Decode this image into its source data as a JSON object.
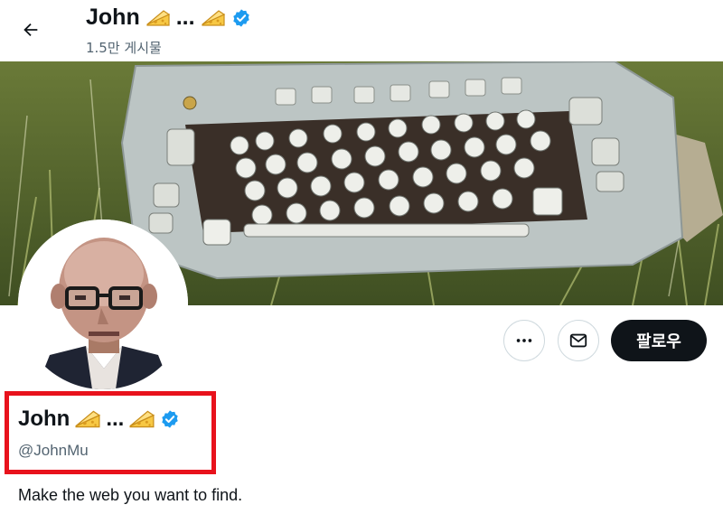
{
  "header": {
    "back_icon": "arrow-left-icon",
    "name": "John",
    "ellipsis": "...",
    "post_count": "1.5만 게시물"
  },
  "profile": {
    "name": "John",
    "ellipsis": "...",
    "handle": "@JohnMu",
    "bio": "Make the web you want to find.",
    "verified_color": "#1d9bf0"
  },
  "actions": {
    "more_icon": "more-icon",
    "message_icon": "mail-icon",
    "follow_label": "팔로우"
  },
  "colors": {
    "highlight": "#e8121c",
    "follow_bg": "#0f1419",
    "secondary_text": "#536471"
  }
}
